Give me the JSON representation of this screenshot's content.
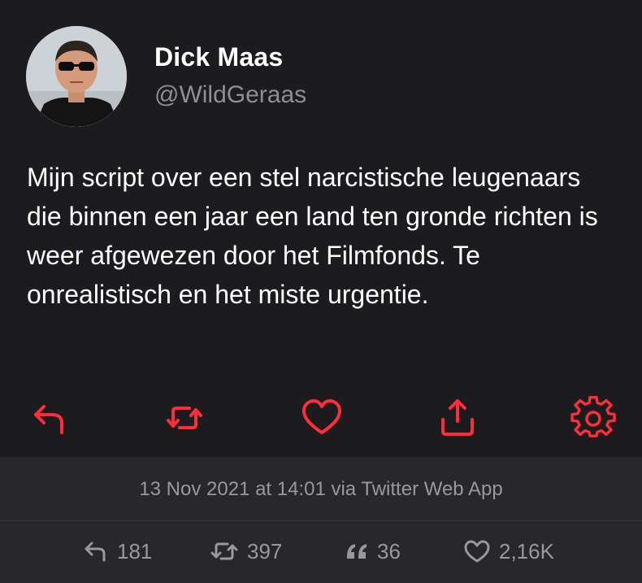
{
  "author": {
    "name": "Dick Maas",
    "handle": "@WildGeraas",
    "avatar_icon": "profile-photo"
  },
  "tweet": {
    "text": "Mijn script over een stel narcistische leugenaars die binnen een jaar een land ten gronde richten is weer afgewezen door het Filmfonds. Te onrealistisch en het miste urgentie."
  },
  "actions": {
    "accent_color": "#ff2d3a",
    "icons": [
      "reply-icon",
      "retweet-icon",
      "like-icon",
      "share-icon",
      "settings-icon"
    ]
  },
  "meta": {
    "timestamp": "13 Nov 2021 at 14:01 via Twitter Web App",
    "stats": {
      "replies": "181",
      "retweets": "397",
      "quotes": "36",
      "likes": "2,16K"
    }
  },
  "colors": {
    "background": "#1c1c1e",
    "panel": "#28282a",
    "text_primary": "#ffffff",
    "text_secondary": "#8e8e93"
  }
}
